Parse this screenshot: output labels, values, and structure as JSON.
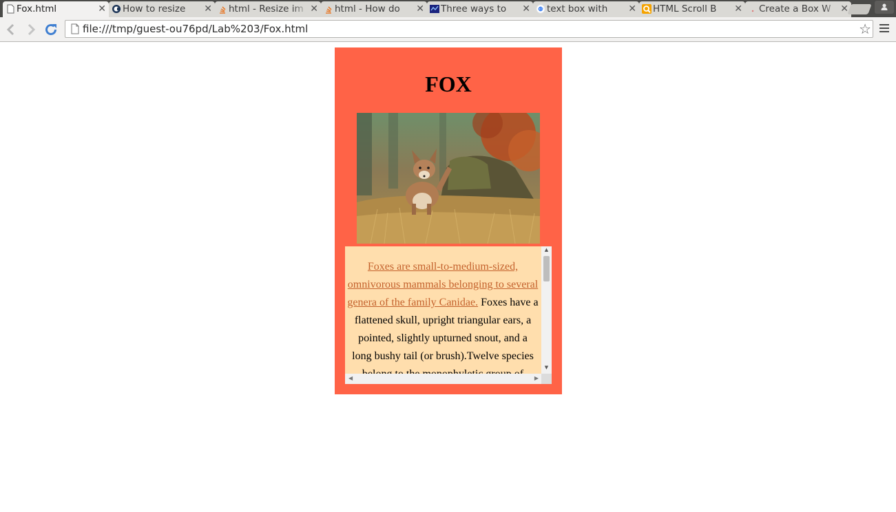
{
  "browser": {
    "tabs": [
      {
        "title": "Fox.html",
        "active": true,
        "icon": "page-icon"
      },
      {
        "title": "How to resize",
        "active": false,
        "icon": "circle-c-icon"
      },
      {
        "title": "html - Resize im",
        "active": false,
        "icon": "stackoverflow-icon"
      },
      {
        "title": "html - How do",
        "active": false,
        "icon": "stackoverflow-icon"
      },
      {
        "title": "Three ways to",
        "active": false,
        "icon": "globe-icon"
      },
      {
        "title": "text box with",
        "active": false,
        "icon": "google-icon"
      },
      {
        "title": "HTML Scroll B",
        "active": false,
        "icon": "search-q-icon"
      },
      {
        "title": "Create a Box W",
        "active": false,
        "icon": "page-icon"
      }
    ],
    "url": "file:///tmp/guest-ou76pd/Lab%203/Fox.html"
  },
  "page": {
    "heading": "FOX",
    "photo_alt_icon": "fox-photo",
    "paragraph_link": "Foxes are small-to-medium-sized, omnivorous mammals belonging to several genera of the family Canidae.",
    "paragraph_rest": " Foxes have a flattened skull, upright triangular ears, a pointed, slightly upturned snout, and a long bushy tail (or brush).Twelve species belong to the monophyletic group of Vulpes genus"
  },
  "colors": {
    "card": "#ff6347",
    "scrollbox": "#ffdead",
    "link": "#c4622d"
  }
}
